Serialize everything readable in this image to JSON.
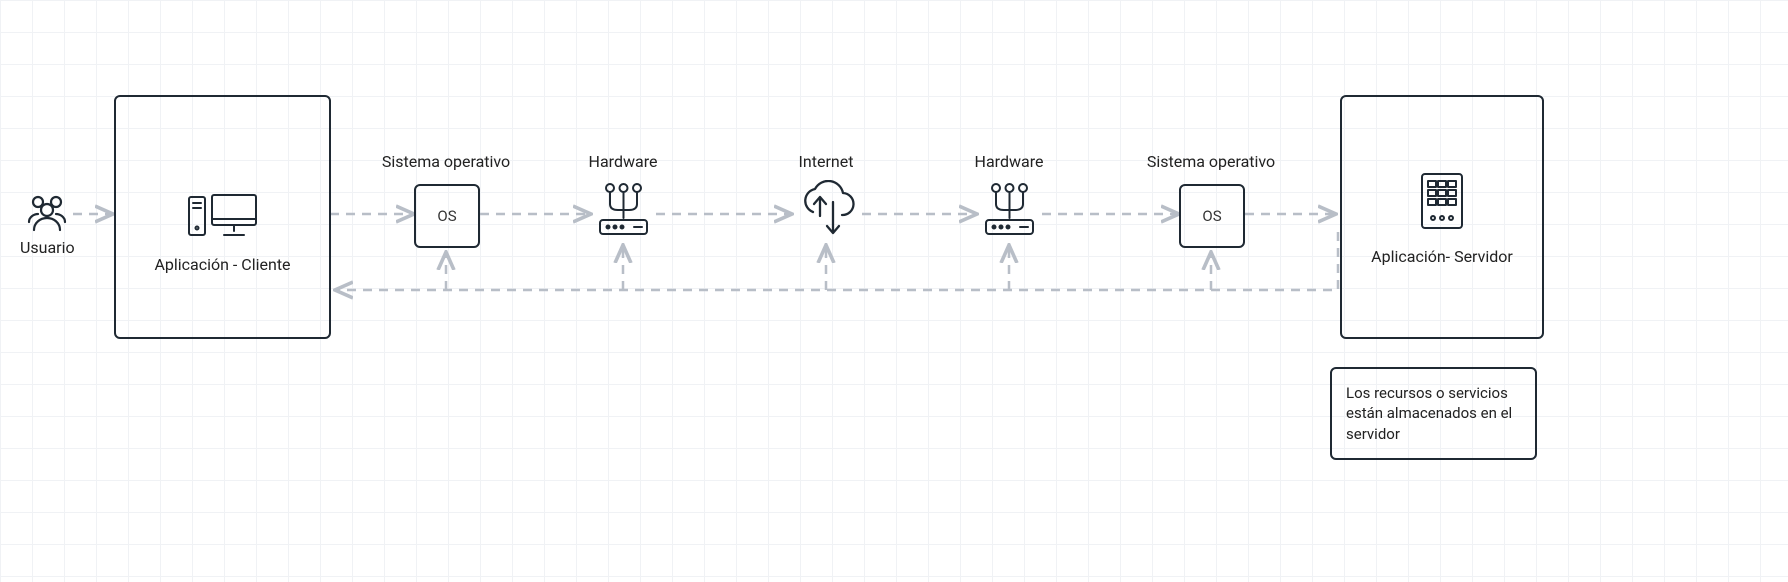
{
  "nodes": {
    "user_label": "Usuario",
    "client_app_label": "Aplicación - Cliente",
    "os1_title": "Sistema operativo",
    "os_box_label": "OS",
    "hw1_title": "Hardware",
    "internet_title": "Internet",
    "hw2_title": "Hardware",
    "os2_title": "Sistema operativo",
    "server_app_label": "Aplicación- Servidor"
  },
  "annotation": "Los recursos o servicios están almacenados en el servidor",
  "colors": {
    "stroke": "#1f2933",
    "dash": "#b8bec7",
    "arrow": "#b8bec7"
  }
}
